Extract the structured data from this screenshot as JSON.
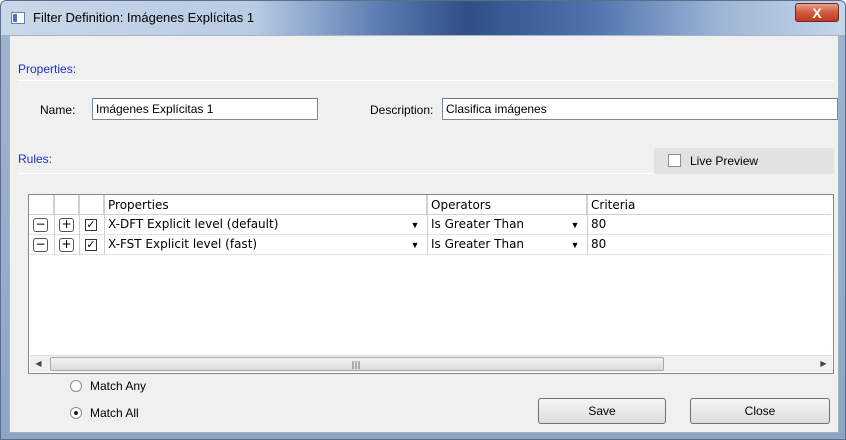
{
  "window": {
    "title": "Filter Definition: Imágenes Explícitas 1",
    "close_glyph": "X"
  },
  "properties_section": {
    "label": "Properties:",
    "name_label": "Name:",
    "name_value": "Imágenes Explícitas 1",
    "description_label": "Description:",
    "description_value": "Clasifica imágenes"
  },
  "rules_section": {
    "label": "Rules:",
    "live_preview_label": "Live Preview",
    "live_preview_checked": false
  },
  "grid": {
    "columns": [
      "Properties",
      "Operators",
      "Criteria"
    ],
    "rows": [
      {
        "checked": true,
        "property": "X-DFT Explicit level (default)",
        "operator": "Is Greater Than",
        "criteria": "80"
      },
      {
        "checked": true,
        "property": "X-FST Explicit level (fast)",
        "operator": "Is Greater Than",
        "criteria": "80"
      }
    ],
    "minus_glyph": "−",
    "plus_glyph": "+",
    "check_glyph": "✓",
    "dropdown_glyph": "▼",
    "scroll_left_glyph": "◀",
    "scroll_right_glyph": "▶",
    "scroll_grip": "III"
  },
  "match": {
    "any_label": "Match Any",
    "all_label": "Match All",
    "selected": "all"
  },
  "buttons": {
    "save": "Save",
    "close": "Close"
  },
  "colors": {
    "section_label": "#1b2fd4",
    "titlebar_accent": "#2f4f86",
    "close_button": "#c0391f"
  }
}
